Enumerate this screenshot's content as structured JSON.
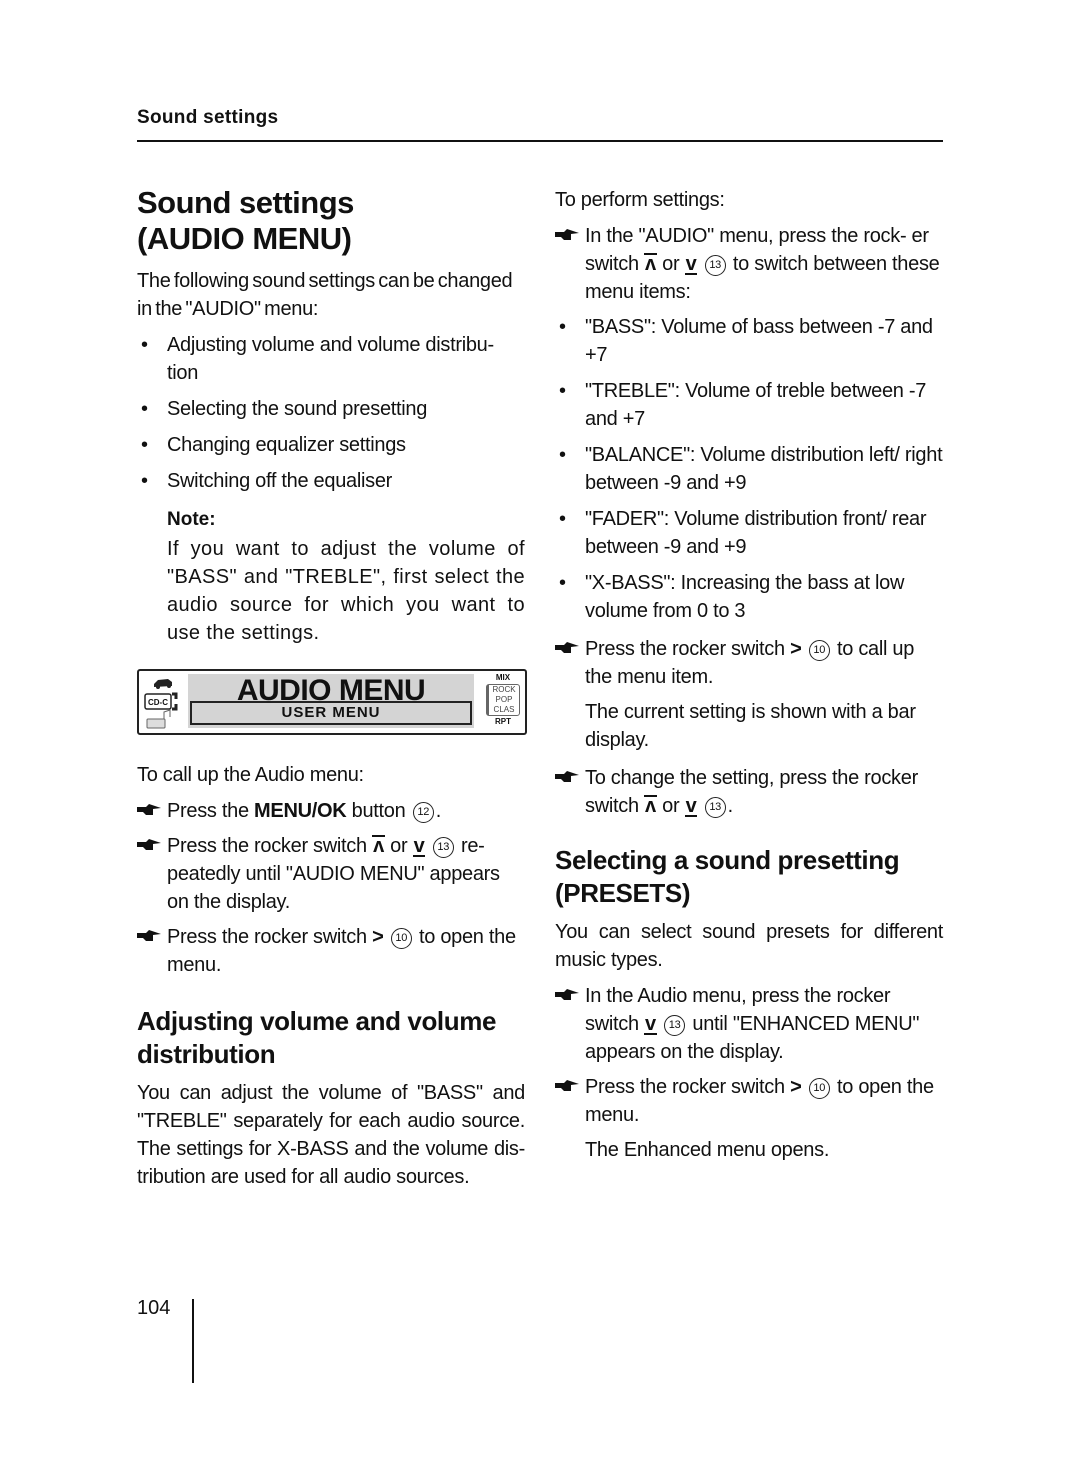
{
  "running_head": "Sound settings",
  "page_number": "104",
  "left": {
    "title_line1": "Sound settings",
    "title_line2": "(AUDIO MENU)",
    "intro": "The following sound settings can be changed in the \"AUDIO\" menu:",
    "bullets": [
      "Adjusting volume and volume distribu- tion",
      "Selecting the sound presetting",
      "Changing equalizer settings",
      "Switching off the equaliser"
    ],
    "note_label": "Note:",
    "note_text": "If you want to adjust the volume of \"BASS\" and \"TREBLE\", first select the audio source for which you want to use the settings.",
    "display": {
      "title": "AUDIO MENU",
      "subtitle": "USER MENU",
      "left_icons": [
        "car-icon",
        "cd-changer-icon",
        "mp3-icon"
      ],
      "cd_label": "CD-C",
      "mix": "MIX",
      "presets": [
        "ROCK",
        "POP",
        "CLAS"
      ],
      "rpt": "RPT"
    },
    "call_up_intro": "To call up the Audio menu:",
    "steps": [
      {
        "pre": "Press the ",
        "bold": "MENU/OK",
        "post": " button",
        "num": "12",
        "end": "."
      },
      {
        "pre": "Press the rocker switch ",
        "sym1": "up",
        "mid": " or ",
        "sym2": "down",
        "num": "13",
        "post": " re- peatedly until \"AUDIO MENU\" appears on the display."
      },
      {
        "pre": "Press the rocker switch ",
        "sym": ">",
        "num": "10",
        "post": " to open the menu."
      }
    ],
    "section2_title": "Adjusting volume and volume distribution",
    "section2_text": "You can adjust the volume of \"BASS\" and \"TREBLE\" separately for each audio source. The settings for X-BASS and the volume dis- tribution are used for all audio sources."
  },
  "right": {
    "perform_intro": "To perform settings:",
    "step1": {
      "pre": "In the \"AUDIO\" menu, press the rock- er switch ",
      "mid": " or ",
      "num": "13",
      "post": " to switch between these menu items:"
    },
    "menu_items": [
      "\"BASS\": Volume of bass between -7 and +7",
      "\"TREBLE\": Volume of treble between -7 and +7",
      "\"BALANCE\": Volume distribution left/ right between -9 and +9",
      "\"FADER\": Volume distribution front/ rear between -9 and +9",
      "\"X-BASS\": Increasing the bass at low volume from 0 to 3"
    ],
    "step2": {
      "pre": "Press the rocker switch ",
      "num": "10",
      "post": " to call up the menu item."
    },
    "step2_result": "The current setting is shown with a bar display.",
    "step3": {
      "pre": "To change the setting, press the rocker switch ",
      "mid": " or ",
      "num": "13",
      "end": "."
    },
    "section_title_line1": "Selecting a sound presetting",
    "section_title_line2": "(PRESETS)",
    "section_text": "You can select sound presets for different music types.",
    "step4": {
      "pre": "In the Audio menu, press the rocker switch ",
      "num": "13",
      "post": " until \"ENHANCED MENU\" appears on the display."
    },
    "step5": {
      "pre": "Press the rocker switch ",
      "num": "10",
      "post": " to open the menu."
    },
    "step5_result": "The Enhanced menu opens."
  },
  "symbols": {
    "gt": ">",
    "up": "ʌ",
    "down": "v"
  }
}
